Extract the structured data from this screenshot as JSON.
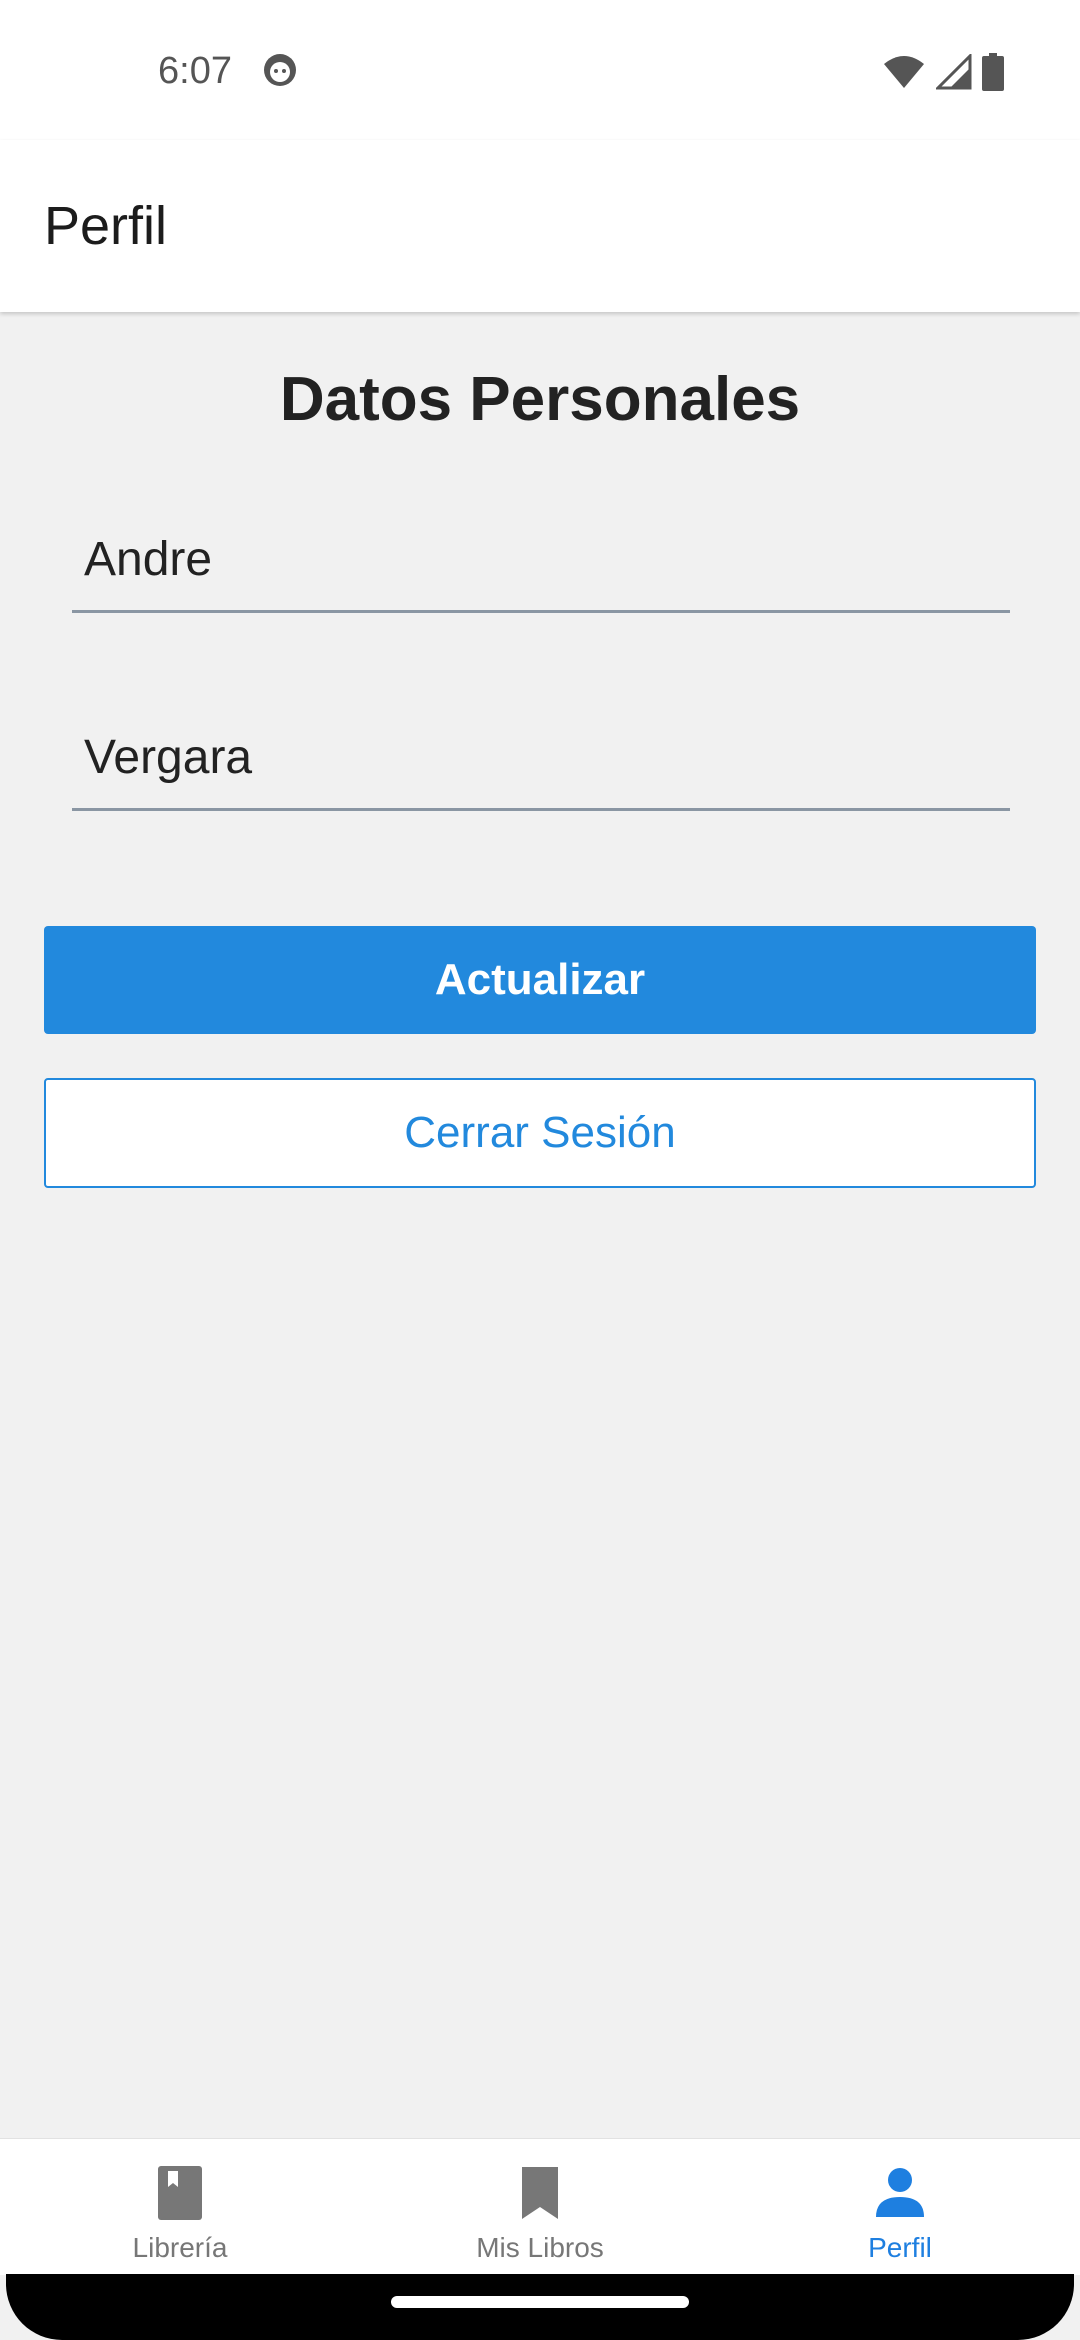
{
  "status_bar": {
    "time": "6:07",
    "icons": [
      "app-notification-icon",
      "wifi-icon",
      "signal-icon",
      "battery-icon"
    ]
  },
  "app_bar": {
    "title": "Perfil"
  },
  "form": {
    "section_title": "Datos Personales",
    "first_name_value": "Andre",
    "last_name_value": "Vergara",
    "update_label": "Actualizar",
    "logout_label": "Cerrar Sesión"
  },
  "bottom_nav": {
    "items": [
      {
        "label": "Librería",
        "icon": "book-icon",
        "active": false
      },
      {
        "label": "Mis Libros",
        "icon": "bookmark-icon",
        "active": false
      },
      {
        "label": "Perfil",
        "icon": "person-icon",
        "active": true
      }
    ]
  },
  "colors": {
    "primary": "#2289dd",
    "active_nav": "#1e7fe0",
    "inactive_nav": "#777777",
    "background": "#f1f1f1"
  }
}
